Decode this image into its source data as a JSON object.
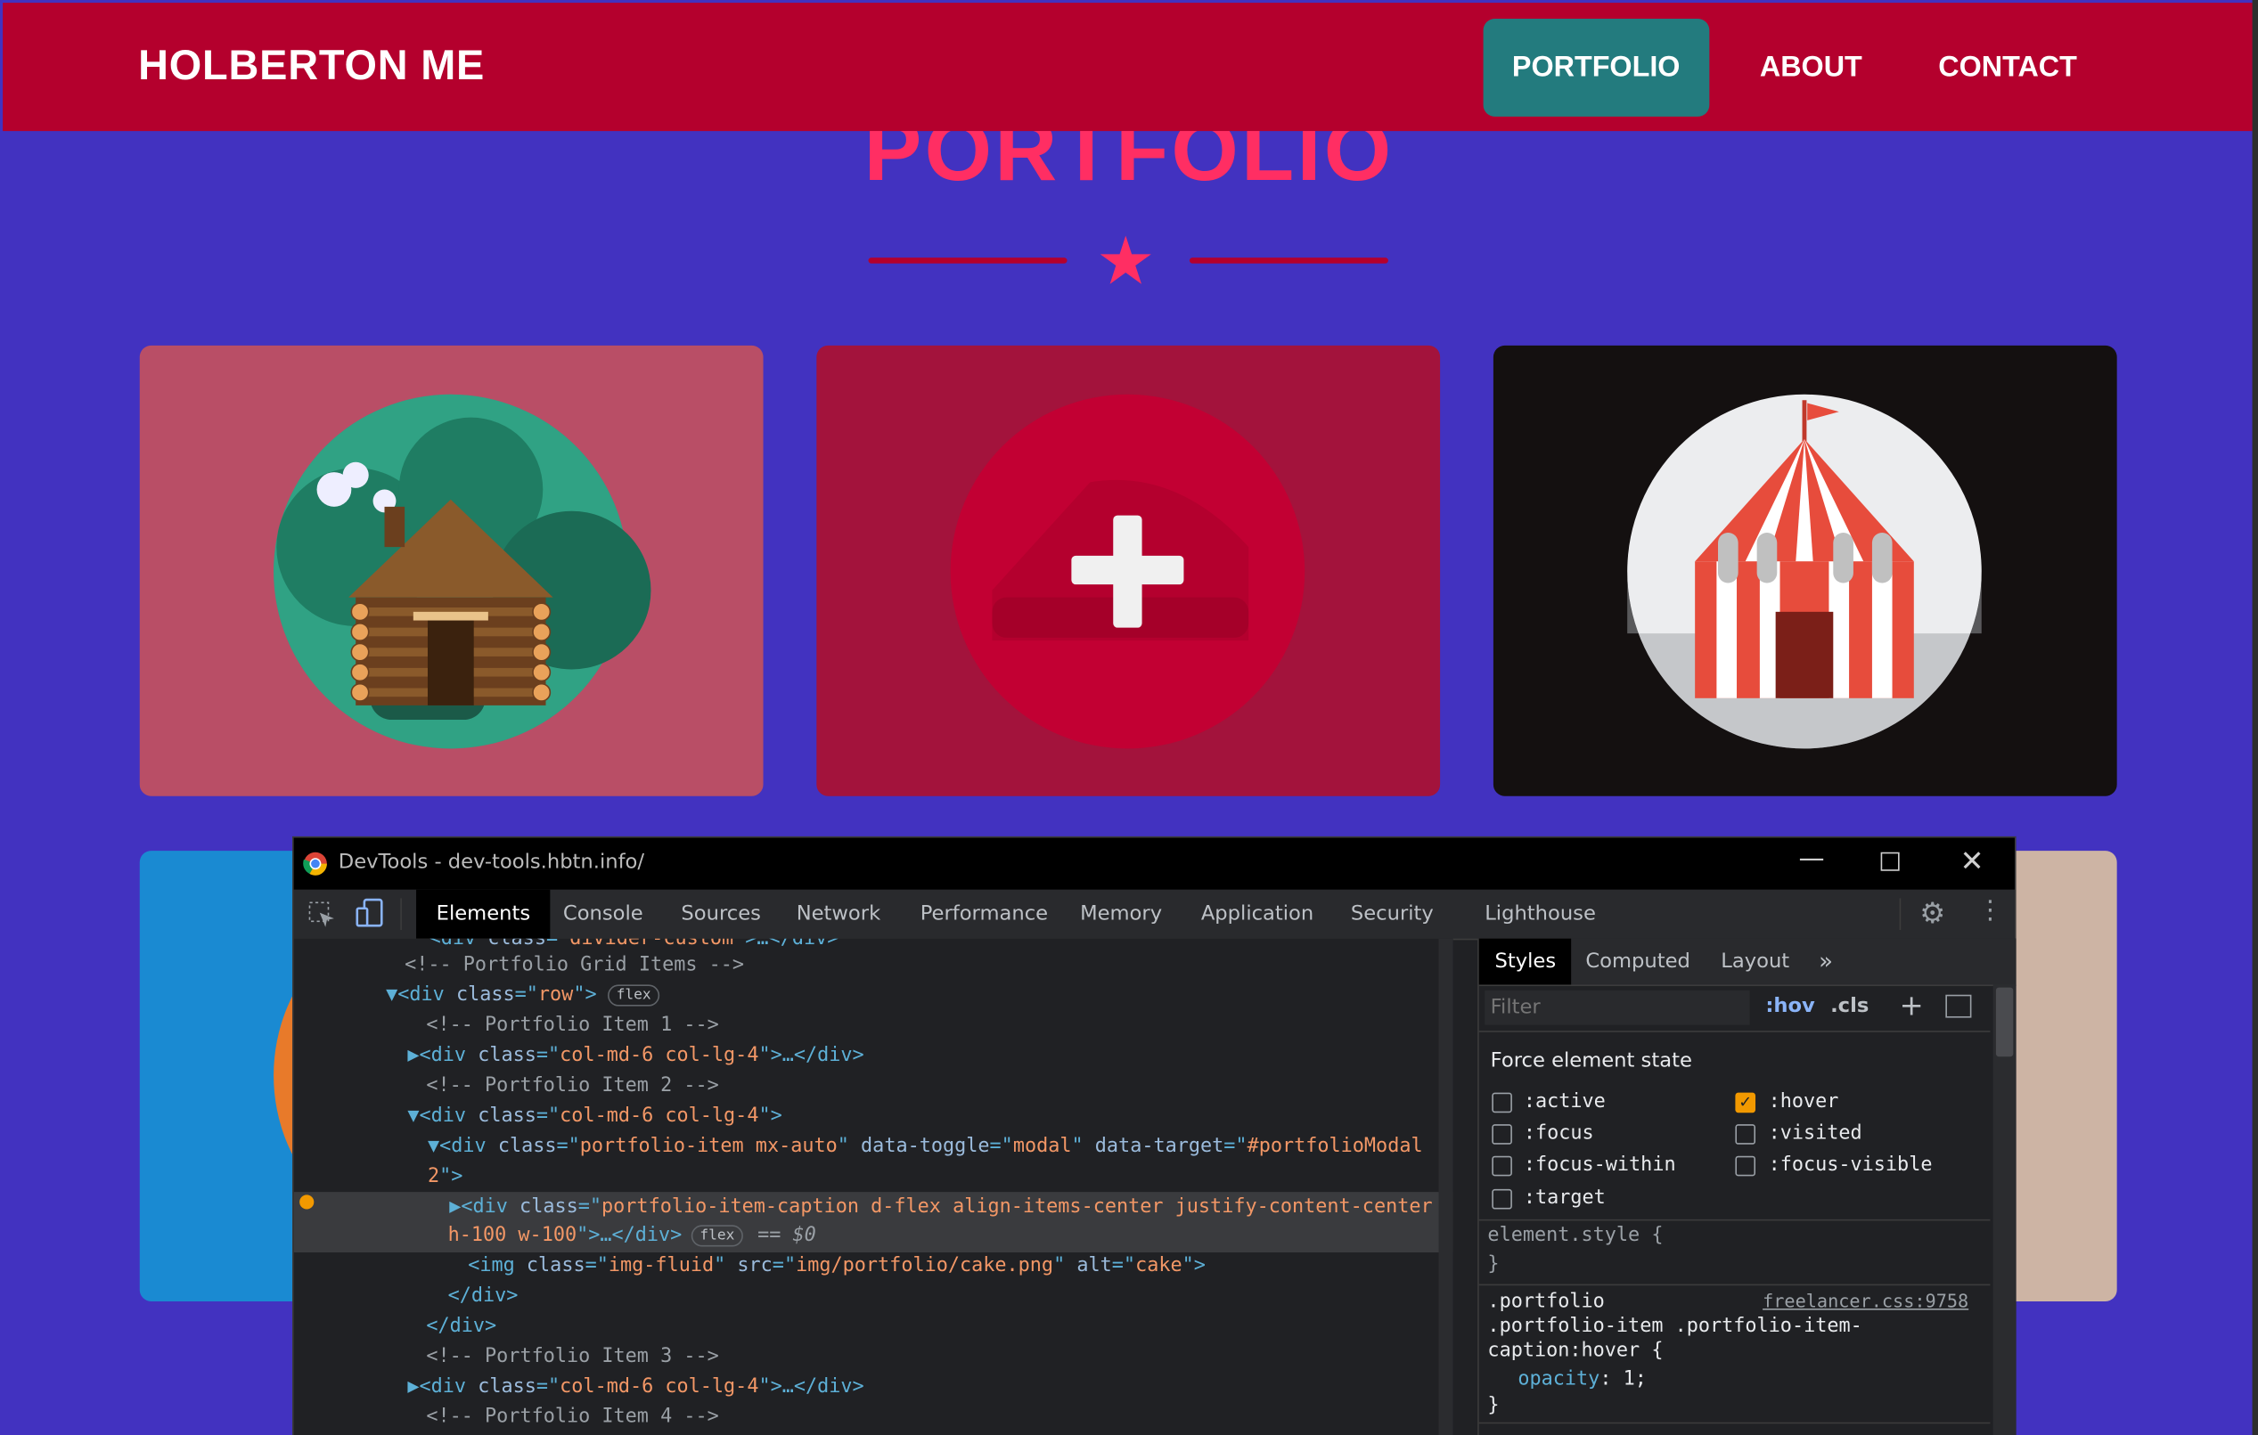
{
  "navbar": {
    "brand": "HOLBERTON ME",
    "items": [
      "PORTFOLIO",
      "ABOUT",
      "CONTACT"
    ],
    "active": "PORTFOLIO"
  },
  "section": {
    "heading": "PORTFOLIO"
  },
  "portfolio": {
    "items": [
      {
        "image": "cabin-illustration",
        "bg": "#b94e66"
      },
      {
        "image": "cake-illustration-hover-overlay",
        "bg": "#a3133c"
      },
      {
        "image": "circus-tent-illustration",
        "bg": "#141010"
      },
      {
        "image": "partial-item-4",
        "bg": "#1a8ad2"
      },
      {
        "image": "partial-item-6",
        "bg": "#cdb4a4"
      }
    ]
  },
  "devtools": {
    "title": "DevTools - dev-tools.hbtn.info/",
    "tabs": [
      "Elements",
      "Console",
      "Sources",
      "Network",
      "Performance",
      "Memory",
      "Application",
      "Security",
      "Lighthouse"
    ],
    "active_tab": "Elements",
    "code_lines": [
      [
        [
          "c-tag",
          "<div "
        ],
        [
          "c-attr",
          "class"
        ],
        [
          "c-tag",
          "=\""
        ],
        [
          "c-val",
          "divider-custom"
        ],
        [
          "c-tag",
          "\">…</div>"
        ]
      ],
      [
        [
          "c-com",
          "<!-- Portfolio Grid Items -->"
        ]
      ],
      [
        [
          "c-tag",
          "▼<div "
        ],
        [
          "c-attr",
          "class"
        ],
        [
          "c-tag",
          "=\""
        ],
        [
          "c-val",
          "row"
        ],
        [
          "c-tag",
          "\">"
        ]
      ],
      [
        [
          "c-com",
          "<!-- Portfolio Item 1 -->"
        ]
      ],
      [
        [
          "c-tag",
          "▶<div "
        ],
        [
          "c-attr",
          "class"
        ],
        [
          "c-tag",
          "=\""
        ],
        [
          "c-val",
          "col-md-6 col-lg-4"
        ],
        [
          "c-tag",
          "\">…</div>"
        ]
      ],
      [
        [
          "c-com",
          "<!-- Portfolio Item 2 -->"
        ]
      ],
      [
        [
          "c-tag",
          "▼<div "
        ],
        [
          "c-attr",
          "class"
        ],
        [
          "c-tag",
          "=\""
        ],
        [
          "c-val",
          "col-md-6 col-lg-4"
        ],
        [
          "c-tag",
          "\">"
        ]
      ],
      [
        [
          "c-tag",
          "▼<div "
        ],
        [
          "c-attr",
          "class"
        ],
        [
          "c-tag",
          "=\""
        ],
        [
          "c-val",
          "portfolio-item mx-auto"
        ],
        [
          "c-tag",
          "\" "
        ],
        [
          "c-attr",
          "data-toggle"
        ],
        [
          "c-tag",
          "=\""
        ],
        [
          "c-val",
          "modal"
        ],
        [
          "c-tag",
          "\" "
        ],
        [
          "c-attr",
          "data-target"
        ],
        [
          "c-tag",
          "=\""
        ],
        [
          "c-val",
          "#portfolioModal"
        ]
      ],
      [
        [
          "c-val",
          "2"
        ],
        [
          "c-tag",
          "\">"
        ]
      ],
      [
        [
          "c-tag",
          "▶<div "
        ],
        [
          "c-attr",
          "class"
        ],
        [
          "c-tag",
          "=\""
        ],
        [
          "c-val",
          "portfolio-item-caption d-flex align-items-center justify-content-center"
        ]
      ],
      [
        [
          "c-val",
          "h-100 w-100"
        ],
        [
          "c-tag",
          "\">…</div>"
        ]
      ],
      [
        [
          "c-tag",
          "<img "
        ],
        [
          "c-attr",
          "class"
        ],
        [
          "c-tag",
          "=\""
        ],
        [
          "c-val",
          "img-fluid"
        ],
        [
          "c-tag",
          "\" "
        ],
        [
          "c-attr",
          "src"
        ],
        [
          "c-tag",
          "=\""
        ],
        [
          "c-val",
          "img/portfolio/cake.png"
        ],
        [
          "c-tag",
          "\" "
        ],
        [
          "c-attr",
          "alt"
        ],
        [
          "c-tag",
          "=\""
        ],
        [
          "c-val",
          "cake"
        ],
        [
          "c-tag",
          "\">"
        ]
      ],
      [
        [
          "c-tag",
          "</div>"
        ]
      ],
      [
        [
          "c-tag",
          "</div>"
        ]
      ],
      [
        [
          "c-com",
          "<!-- Portfolio Item 3 -->"
        ]
      ],
      [
        [
          "c-tag",
          "▶<div "
        ],
        [
          "c-attr",
          "class"
        ],
        [
          "c-tag",
          "=\""
        ],
        [
          "c-val",
          "col-md-6 col-lg-4"
        ],
        [
          "c-tag",
          "\">…</div>"
        ]
      ],
      [
        [
          "c-com",
          "<!-- Portfolio Item 4 -->"
        ]
      ]
    ],
    "badges": {
      "flex": "flex"
    },
    "selected_marker": "== $0",
    "styles": {
      "tabs": [
        "Styles",
        "Computed",
        "Layout"
      ],
      "more": "»",
      "filter_placeholder": "Filter",
      "hov": ":hov",
      "cls": ".cls",
      "force_state_title": "Force element state",
      "states_left": [
        ":active",
        ":focus",
        ":focus-within",
        ":target"
      ],
      "states_right": [
        ":hover",
        ":visited",
        ":focus-visible"
      ],
      "checked": ":hover",
      "element_style": "element.style {",
      "close_brace": "}",
      "rule_selector_1": ".portfolio",
      "rule_selector_2": ".portfolio-item .portfolio-item-",
      "rule_selector_3": "caption:hover {",
      "rule_source": "freelancer.css:9758",
      "rule_prop": "opacity",
      "rule_value": "1;"
    }
  }
}
